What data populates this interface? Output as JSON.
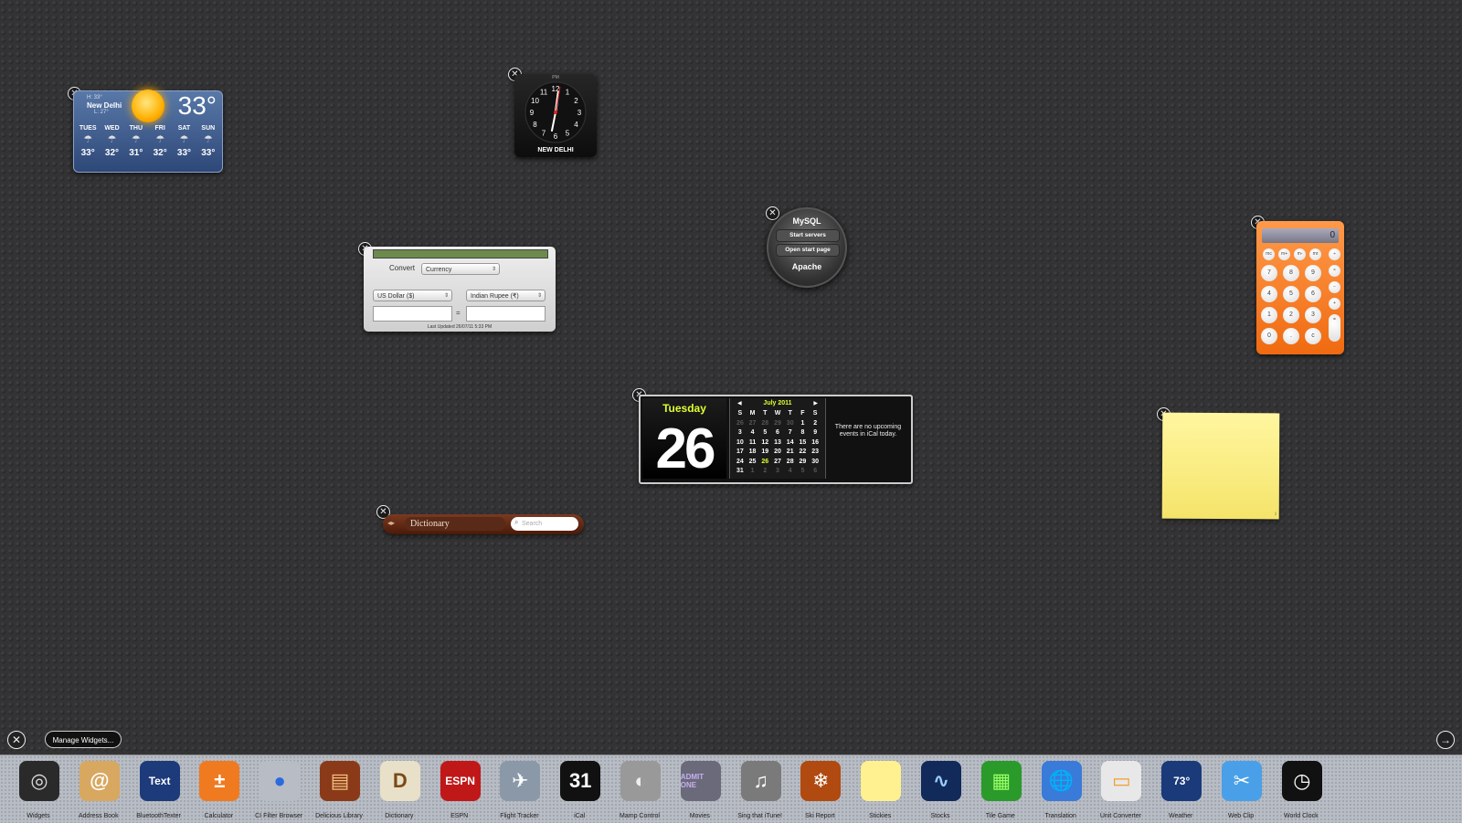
{
  "weather": {
    "city": "New Delhi",
    "high": "H: 33°",
    "low": "L: 27°",
    "current_temp": "33°",
    "days": [
      {
        "day": "TUES",
        "temp": "33°"
      },
      {
        "day": "WED",
        "temp": "32°"
      },
      {
        "day": "THU",
        "temp": "31°"
      },
      {
        "day": "FRI",
        "temp": "32°"
      },
      {
        "day": "SAT",
        "temp": "33°"
      },
      {
        "day": "SUN",
        "temp": "33°"
      }
    ]
  },
  "clock": {
    "city": "NEW DELHI",
    "ampm": "PM",
    "numbers": [
      "12",
      "1",
      "2",
      "3",
      "4",
      "5",
      "6",
      "7",
      "8",
      "9",
      "10",
      "11"
    ]
  },
  "currency": {
    "convert_label": "Convert",
    "category": "Currency",
    "from": "US Dollar ($)",
    "to": "Indian Rupee (₹)",
    "equals": "=",
    "updated": "Last Updated 26/07/11 5:33 PM"
  },
  "mysql": {
    "title": "MySQL",
    "start": "Start servers",
    "open": "Open start page",
    "apache": "Apache"
  },
  "calculator": {
    "display": "0",
    "memory_keys": [
      "mc",
      "m+",
      "m-",
      "mr"
    ],
    "keys": [
      "7",
      "8",
      "9",
      "4",
      "5",
      "6",
      "1",
      "2",
      "3",
      "0",
      ".",
      "c"
    ],
    "ops": [
      "÷",
      "×",
      "−",
      "+",
      "="
    ]
  },
  "ical": {
    "weekday": "Tuesday",
    "date": "26",
    "month_title": "July 2011",
    "weekdays": [
      "S",
      "M",
      "T",
      "W",
      "T",
      "F",
      "S"
    ],
    "days": [
      [
        "26",
        "dim"
      ],
      [
        "27",
        "dim"
      ],
      [
        "28",
        "dim"
      ],
      [
        "29",
        "dim"
      ],
      [
        "30",
        "dim"
      ],
      [
        "1",
        ""
      ],
      [
        "2",
        ""
      ],
      [
        "3",
        ""
      ],
      [
        "4",
        ""
      ],
      [
        "5",
        ""
      ],
      [
        "6",
        ""
      ],
      [
        "7",
        ""
      ],
      [
        "8",
        ""
      ],
      [
        "9",
        ""
      ],
      [
        "10",
        ""
      ],
      [
        "11",
        ""
      ],
      [
        "12",
        ""
      ],
      [
        "13",
        ""
      ],
      [
        "14",
        ""
      ],
      [
        "15",
        ""
      ],
      [
        "16",
        ""
      ],
      [
        "17",
        ""
      ],
      [
        "18",
        ""
      ],
      [
        "19",
        ""
      ],
      [
        "20",
        ""
      ],
      [
        "21",
        ""
      ],
      [
        "22",
        ""
      ],
      [
        "23",
        ""
      ],
      [
        "24",
        ""
      ],
      [
        "25",
        ""
      ],
      [
        "26",
        "today"
      ],
      [
        "27",
        ""
      ],
      [
        "28",
        ""
      ],
      [
        "29",
        ""
      ],
      [
        "30",
        ""
      ],
      [
        "31",
        ""
      ],
      [
        "1",
        "dim"
      ],
      [
        "2",
        "dim"
      ],
      [
        "3",
        "dim"
      ],
      [
        "4",
        "dim"
      ],
      [
        "5",
        "dim"
      ],
      [
        "6",
        "dim"
      ]
    ],
    "events_text": "There are no upcoming events in iCal today."
  },
  "dictionary": {
    "selected": "Dictionary",
    "search_placeholder": "Search"
  },
  "controls": {
    "manage": "Manage Widgets..."
  },
  "tray": [
    {
      "name": "Widgets",
      "icon": "widgets-icon",
      "bg": "#2a2a2a",
      "glyph": "◎",
      "fg": "#ddd"
    },
    {
      "name": "Address Book",
      "icon": "address-book-icon",
      "bg": "#d8a860",
      "glyph": "@",
      "fg": "#fff"
    },
    {
      "name": "BluetoothTexter",
      "icon": "bluetooth-texter-icon",
      "bg": "#1d3a7a",
      "glyph": "Text",
      "fg": "#fff"
    },
    {
      "name": "Calculator",
      "icon": "calculator-icon",
      "bg": "#f07a20",
      "glyph": "±",
      "fg": "#fff"
    },
    {
      "name": "CI Filter Browser",
      "icon": "ci-filter-icon",
      "bg": "#b8bcc4",
      "glyph": "●",
      "fg": "#2a6adf"
    },
    {
      "name": "Delicious Library",
      "icon": "delicious-library-icon",
      "bg": "#8a3a18",
      "glyph": "▤",
      "fg": "#f0c080"
    },
    {
      "name": "Dictionary",
      "icon": "dictionary-icon",
      "bg": "#e8e0c8",
      "glyph": "D",
      "fg": "#7a4a18"
    },
    {
      "name": "ESPN",
      "icon": "espn-icon",
      "bg": "#c01818",
      "glyph": "ESPN",
      "fg": "#fff"
    },
    {
      "name": "Flight Tracker",
      "icon": "flight-tracker-icon",
      "bg": "#8a98a8",
      "glyph": "✈",
      "fg": "#fff"
    },
    {
      "name": "iCal",
      "icon": "ical-icon",
      "bg": "#111",
      "glyph": "31",
      "fg": "#fff"
    },
    {
      "name": "Mamp Control",
      "icon": "mamp-control-icon",
      "bg": "#999",
      "glyph": "◐",
      "fg": "#eee"
    },
    {
      "name": "Movies",
      "icon": "movies-icon",
      "bg": "#6a6a7a",
      "glyph": "ADMIT ONE",
      "fg": "#c8b0f0"
    },
    {
      "name": "Sing that iTune!",
      "icon": "itunes-icon",
      "bg": "#7a7a7a",
      "glyph": "♫",
      "fg": "#fff"
    },
    {
      "name": "Ski Report",
      "icon": "ski-report-icon",
      "bg": "#b04a10",
      "glyph": "❄",
      "fg": "#fff"
    },
    {
      "name": "Stickies",
      "icon": "stickies-icon",
      "bg": "#fff090",
      "glyph": "",
      "fg": "#333"
    },
    {
      "name": "Stocks",
      "icon": "stocks-icon",
      "bg": "#122a5a",
      "glyph": "∿",
      "fg": "#9cf"
    },
    {
      "name": "Tile Game",
      "icon": "tile-game-icon",
      "bg": "#2a9a2a",
      "glyph": "▦",
      "fg": "#9f6"
    },
    {
      "name": "Translation",
      "icon": "translation-icon",
      "bg": "#3a7ad8",
      "glyph": "🌐",
      "fg": "#fff"
    },
    {
      "name": "Unit Converter",
      "icon": "unit-converter-icon",
      "bg": "#e8e8e8",
      "glyph": "▭",
      "fg": "#f0a030"
    },
    {
      "name": "Weather",
      "icon": "weather-icon",
      "bg": "#1a3a7a",
      "glyph": "73°",
      "fg": "#fff"
    },
    {
      "name": "Web Clip",
      "icon": "web-clip-icon",
      "bg": "#4aa0e8",
      "glyph": "✂",
      "fg": "#fff"
    },
    {
      "name": "World Clock",
      "icon": "world-clock-icon",
      "bg": "#111",
      "glyph": "◷",
      "fg": "#fff"
    }
  ]
}
